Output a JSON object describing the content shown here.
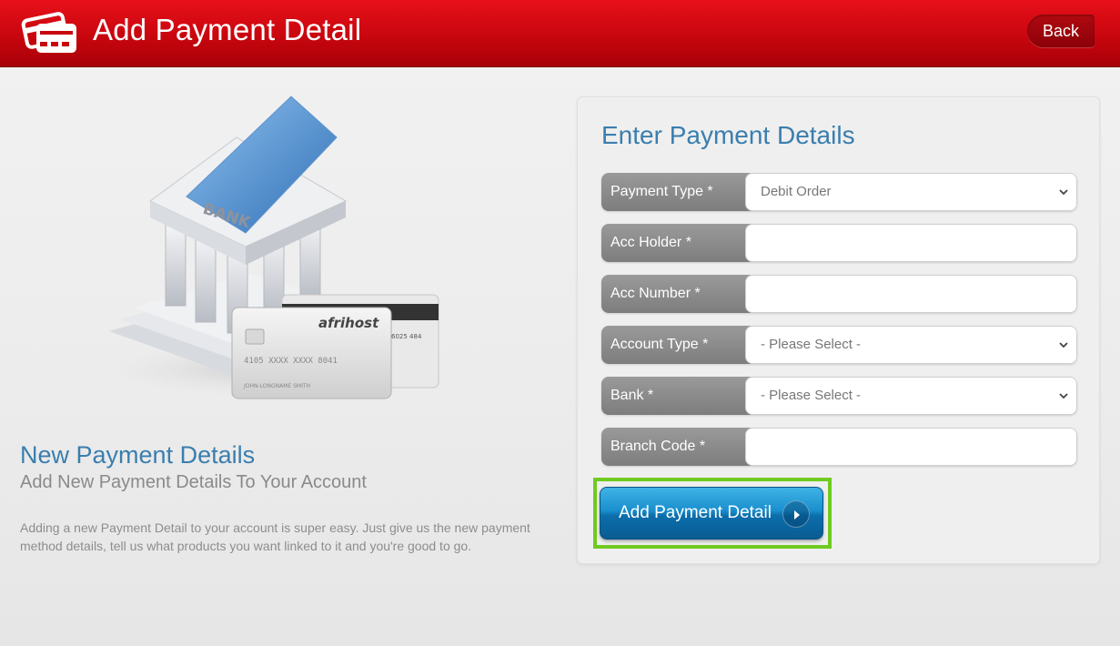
{
  "header": {
    "title": "Add Payment Detail",
    "back_label": "Back",
    "icon": "payment-cards-icon"
  },
  "left": {
    "heading": "New Payment Details",
    "subheading": "Add New Payment Details To Your Account",
    "description": "Adding a new Payment Detail to your account is super easy. Just give us the new payment method details, tell us what products you want linked to it and you're good to go.",
    "illustration": {
      "bank_sign": "BANK",
      "card_brand": "afrihost",
      "card_number": "4105 XXXX XXXX 8041",
      "card_holder": "JOHN-LONGNAME SMITH",
      "card_back_code": "6025 484"
    }
  },
  "form": {
    "title": "Enter Payment Details",
    "fields": [
      {
        "label": "Payment Type *",
        "type": "select",
        "value": "Debit Order"
      },
      {
        "label": "Acc Holder *",
        "type": "text",
        "value": ""
      },
      {
        "label": "Acc Number *",
        "type": "text",
        "value": ""
      },
      {
        "label": "Account Type *",
        "type": "select",
        "value": "- Please Select -"
      },
      {
        "label": "Bank *",
        "type": "select",
        "value": "- Please Select -"
      },
      {
        "label": "Branch Code *",
        "type": "text",
        "value": ""
      }
    ],
    "submit_label": "Add Payment Detail"
  },
  "colors": {
    "header_red": "#d4080f",
    "accent_blue": "#3a7eae",
    "button_blue": "#1a8fce",
    "highlight_green": "#6fcb1f"
  }
}
